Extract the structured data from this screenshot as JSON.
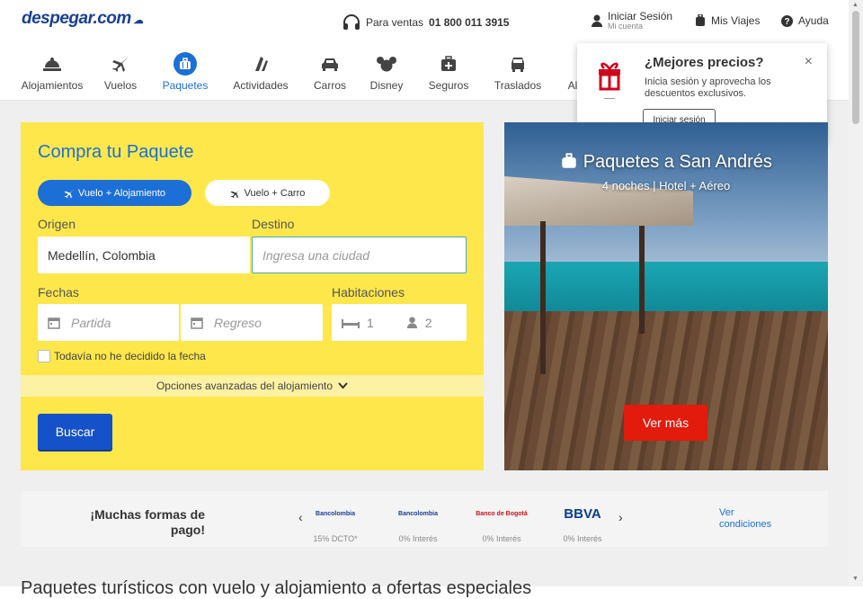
{
  "header": {
    "logo": "despegar",
    "logo_suffix": ".com",
    "sales_label": "Para ventas",
    "sales_phone": "01 800 011 3915",
    "login_label": "Iniciar Sesión",
    "login_sub": "Mi cuenta",
    "trips_label": "Mis Viajes",
    "help_label": "Ayuda"
  },
  "nav": {
    "items": [
      {
        "label": "Alojamientos",
        "icon": "hotel-bell-icon"
      },
      {
        "label": "Vuelos",
        "icon": "plane-icon"
      },
      {
        "label": "Paquetes",
        "icon": "suitcase-icon",
        "active": true
      },
      {
        "label": "Actividades",
        "icon": "activities-icon"
      },
      {
        "label": "Carros",
        "icon": "car-icon"
      },
      {
        "label": "Disney",
        "icon": "disney-icon"
      },
      {
        "label": "Seguros",
        "icon": "insurance-icon"
      },
      {
        "label": "Traslados",
        "icon": "transfer-icon"
      },
      {
        "label": "Al",
        "icon": "more-icon"
      }
    ]
  },
  "popover": {
    "title": "¿Mejores precios?",
    "text": "Inicia sesión y aprovecha los descuentos exclusivos.",
    "button": "Iniciar sesión",
    "close": "×"
  },
  "search": {
    "title": "Compra tu Paquete",
    "tab_active": "Vuelo + Alojamiento",
    "tab_other": "Vuelo + Carro",
    "origin_label": "Origen",
    "origin_value": "Medellín, Colombia",
    "destination_label": "Destino",
    "destination_placeholder": "Ingresa una ciudad",
    "dates_label": "Fechas",
    "departure_placeholder": "Partida",
    "return_placeholder": "Regreso",
    "rooms_label": "Habitaciones",
    "rooms_value": "1",
    "guests_value": "2",
    "undecided_label": "Todavía no he decidido la fecha",
    "advanced_label": "Opciones avanzadas del alojamiento",
    "search_button": "Buscar"
  },
  "promo": {
    "title": "Paquetes a San Andrés",
    "subtitle": "4 noches | Hotel + Aéreo",
    "button": "Ver más"
  },
  "payment": {
    "title_line1": "¡Muchas formas de",
    "title_line2": "pago!",
    "prev": "‹",
    "next": "›",
    "banks": [
      {
        "name": "Bancolombia",
        "caption": "15% DCTO*"
      },
      {
        "name": "Bancolombia",
        "caption": "0% Interés"
      },
      {
        "name": "Banco de Bogotá",
        "caption": "0% Interés"
      },
      {
        "name": "BBVA",
        "caption": "0% Interés"
      }
    ],
    "conditions_line1": "Ver",
    "conditions_line2": "condiciones"
  },
  "bottom_text": "Paquetes turísticos con vuelo y alojamiento a ofertas especiales",
  "colors": {
    "brand_blue": "#1c6fd7",
    "yellow": "#fde74b",
    "red": "#e21b0c"
  }
}
